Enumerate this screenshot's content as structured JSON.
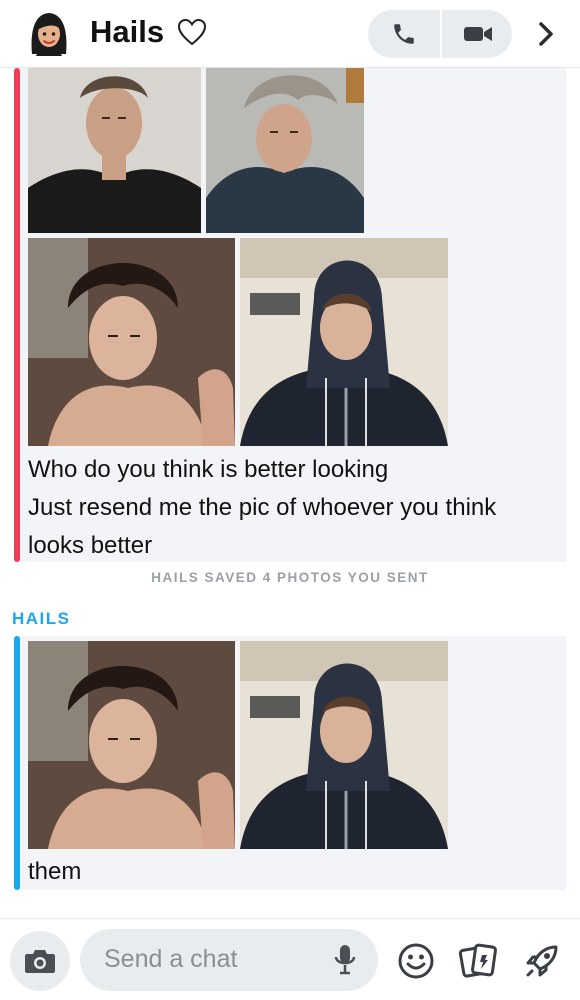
{
  "header": {
    "contact_name": "Hails",
    "icons": [
      "bitmoji-avatar",
      "heart-outline-icon",
      "phone-icon",
      "video-camera-icon",
      "chevron-right-icon"
    ]
  },
  "messages": [
    {
      "sender": "me",
      "bar_color": "#f23c57",
      "photos": [
        "photo-1",
        "photo-2",
        "photo-3",
        "photo-4"
      ],
      "text_lines": [
        "Who do you think is better looking",
        "Just resend me the pic of whoever you think",
        "looks better"
      ]
    },
    {
      "sender": "HAILS",
      "bar_color": "#18a8f0",
      "photos": [
        "photo-3",
        "photo-4"
      ],
      "text_lines": [
        "them"
      ]
    }
  ],
  "system_note": "HAILS SAVED 4 PHOTOS YOU SENT",
  "composer": {
    "placeholder": "Send a chat",
    "icons": [
      "camera-icon",
      "microphone-icon",
      "smiley-icon",
      "cards-icon",
      "rocket-icon"
    ]
  },
  "colors": {
    "accent_me": "#f23c57",
    "accent_them": "#18a8f0",
    "bubble_bg": "#f3f4f8"
  }
}
